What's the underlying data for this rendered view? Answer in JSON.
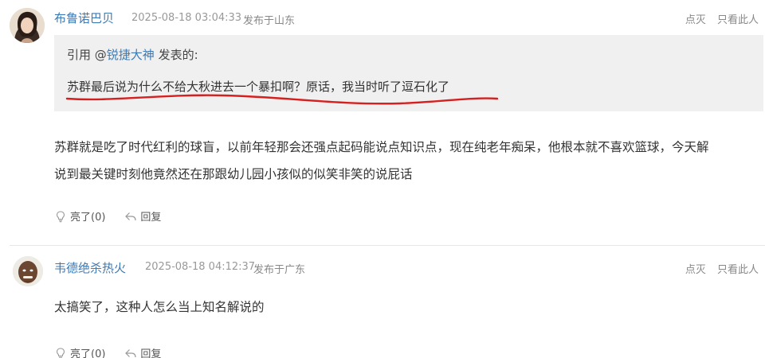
{
  "comments": [
    {
      "username": "布鲁诺巴贝",
      "time": "2025-08-18 03:04:33",
      "location": "发布于山东",
      "actions_right": {
        "down": "点灭",
        "only_this": "只看此人"
      },
      "quote": {
        "prefix": "引用 @",
        "mention": "锐捷大神",
        "suffix": " 发表的:",
        "text": "苏群最后说为什么不给大秋进去一个暴扣啊？原话，我当时听了逗石化了"
      },
      "body": "苏群就是吃了时代红利的球盲，以前年轻那会还强点起码能说点知识点，现在纯老年痴呆，他根本就不喜欢篮球，今天解说到最关键时刻他竟然还在那跟幼儿园小孩似的似笑非笑的说屁话",
      "like_label": "亮了(0)",
      "reply_label": "回复"
    },
    {
      "username": "韦德绝杀热火",
      "time": "2025-08-18 04:12:37",
      "location": "发布于广东",
      "actions_right": {
        "down": "点灭",
        "only_this": "只看此人"
      },
      "body": "太搞笑了，这种人怎么当上知名解说的",
      "like_label": "亮了(0)",
      "reply_label": "回复"
    }
  ],
  "colors": {
    "username": "#3d7ab3",
    "meta": "#999999",
    "quote_bg": "#f0f0f0",
    "underline_mark": "#d62020"
  }
}
